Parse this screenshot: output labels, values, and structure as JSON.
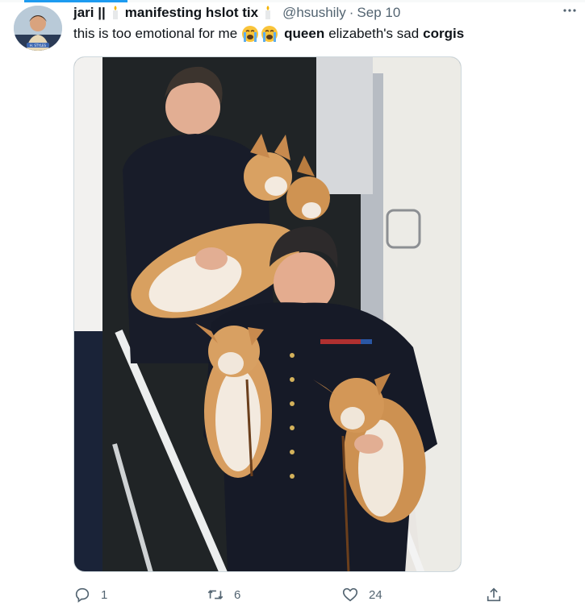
{
  "tweet": {
    "author_name": "jari || ",
    "author_name_2": "manifesting hslot tix",
    "handle": "@hsushily",
    "separator": "·",
    "date": "Sep 10",
    "text_start": "this is too emotional for me",
    "text_bold_1": "queen",
    "text_mid": "elizabeth's sad",
    "text_bold_2": "corgis",
    "avatar_caption": "H. STYLES"
  },
  "actions": {
    "reply_count": "1",
    "retweet_count": "6",
    "like_count": "24"
  },
  "colors": {
    "accent": "#1d9bf0",
    "muted": "#536471",
    "text": "#0f1419"
  },
  "icons": [
    "more-icon",
    "candle-emoji-icon",
    "crying-emoji-icon",
    "reply-icon",
    "retweet-icon",
    "like-icon",
    "share-icon"
  ]
}
